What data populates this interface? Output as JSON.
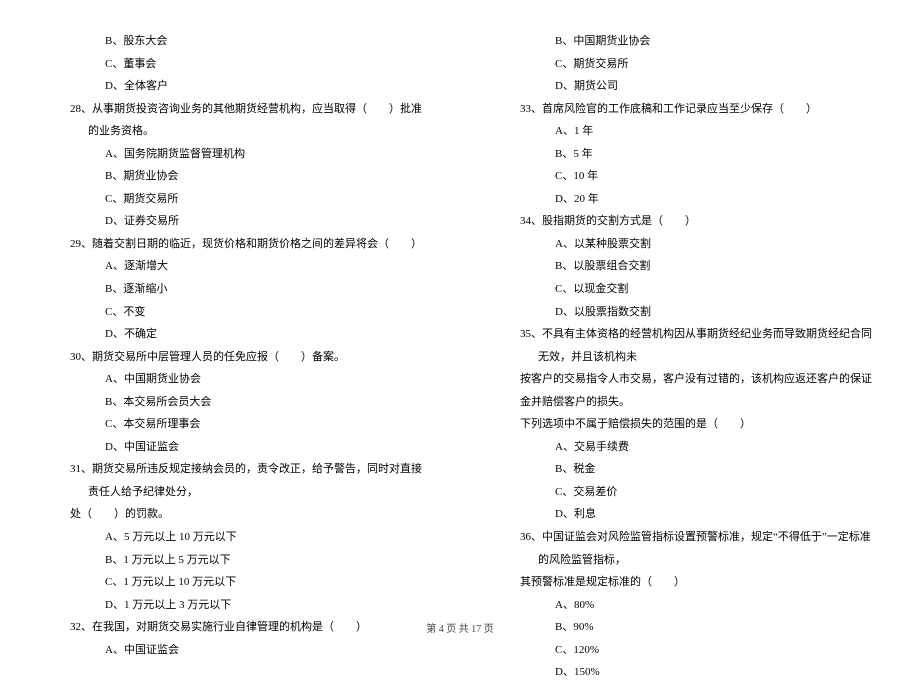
{
  "left_column": {
    "opt_27B": "B、股东大会",
    "opt_27C": "C、董事会",
    "opt_27D": "D、全体客户",
    "q28": "28、从事期货投资咨询业务的其他期货经营机构，应当取得（　　）批准的业务资格。",
    "opt_28A": "A、国务院期货监督管理机构",
    "opt_28B": "B、期货业协会",
    "opt_28C": "C、期货交易所",
    "opt_28D": "D、证券交易所",
    "q29": "29、随着交割日期的临近，现货价格和期货价格之间的差异将会（　　）",
    "opt_29A": "A、逐渐增大",
    "opt_29B": "B、逐渐缩小",
    "opt_29C": "C、不变",
    "opt_29D": "D、不确定",
    "q30": "30、期货交易所中层管理人员的任免应报（　　）备案。",
    "opt_30A": "A、中国期货业协会",
    "opt_30B": "B、本交易所会员大会",
    "opt_30C": "C、本交易所理事会",
    "opt_30D": "D、中国证监会",
    "q31": "31、期货交易所违反规定接纳会员的，责令改正，给予警告，同时对直接责任人给予纪律处分，",
    "q31_cont": "处（　　）的罚款。",
    "opt_31A": "A、5 万元以上 10 万元以下",
    "opt_31B": "B、1 万元以上 5 万元以下",
    "opt_31C": "C、1 万元以上 10 万元以下",
    "opt_31D": "D、1 万元以上 3 万元以下",
    "q32": "32、在我国，对期货交易实施行业自律管理的机构是（　　）",
    "opt_32A": "A、中国证监会"
  },
  "right_column": {
    "opt_32B": "B、中国期货业协会",
    "opt_32C": "C、期货交易所",
    "opt_32D": "D、期货公司",
    "q33": "33、首席风险官的工作底稿和工作记录应当至少保存（　　）",
    "opt_33A": "A、1 年",
    "opt_33B": "B、5 年",
    "opt_33C": "C、10 年",
    "opt_33D": "D、20 年",
    "q34": "34、股指期货的交割方式是（　　）",
    "opt_34A": "A、以某种股票交割",
    "opt_34B": "B、以股票组合交割",
    "opt_34C": "C、以现金交割",
    "opt_34D": "D、以股票指数交割",
    "q35": "35、不具有主体资格的经营机构因从事期货经纪业务而导致期货经纪合同无效，并且该机构未",
    "q35_cont1": "按客户的交易指令人市交易，客户没有过错的，该机构应返还客户的保证金并赔偿客户的损失。",
    "q35_cont2": "下列选项中不属于赔偿损失的范围的是（　　）",
    "opt_35A": "A、交易手续费",
    "opt_35B": "B、税金",
    "opt_35C": "C、交易差价",
    "opt_35D": "D、利息",
    "q36": "36、中国证监会对风险监管指标设置预警标准，规定“不得低于”一定标准的风险监管指标，",
    "q36_cont": "其预警标准是规定标准的（　　）",
    "opt_36A": "A、80%",
    "opt_36B": "B、90%",
    "opt_36C": "C、120%",
    "opt_36D": "D、150%"
  },
  "footer": "第 4 页 共 17 页"
}
